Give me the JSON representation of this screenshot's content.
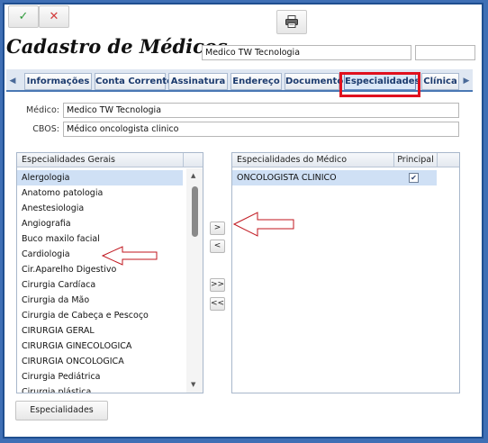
{
  "toolbar": {
    "confirm_icon": "✓",
    "cancel_icon": "✕",
    "print_icon": "🖶"
  },
  "header": {
    "title": "Cadastro de Médicos",
    "name_value": "Medico TW Tecnologia",
    "extra_value": ""
  },
  "tabs": {
    "items": [
      "Informações",
      "Conta Corrente",
      "Assinatura",
      "Endereço",
      "Documento",
      "Especialidades",
      "Clínica"
    ],
    "active": "Especialidades",
    "left_arrow": "◀",
    "right_arrow": "▶"
  },
  "form": {
    "medico_label": "Médico:",
    "medico_value": "Medico TW Tecnologia",
    "cbos_label": "CBOS:",
    "cbos_value": "Médico oncologista clinico"
  },
  "especialidades_gerais": {
    "header": "Especialidades Gerais",
    "items": [
      "Alergologia",
      "Anatomo patologia",
      "Anestesiologia",
      "Angiografia",
      "Buco maxilo facial",
      "Cardiologia",
      "Cir.Aparelho Digestivo",
      "Cirurgia Cardíaca",
      "Cirurgia da Mão",
      "Cirurgia de Cabeça e Pescoço",
      "CIRURGIA GERAL",
      "CIRURGIA GINECOLOGICA",
      "CIRURGIA ONCOLOGICA",
      "Cirurgia Pediátrica",
      "Cirurgia plástica"
    ],
    "selected": "Alergologia"
  },
  "transfer": {
    "add_one": ">",
    "remove_one": "<",
    "add_all": ">>",
    "remove_all": "<<"
  },
  "especialidades_medico": {
    "header_name": "Especialidades do Médico",
    "header_principal": "Principal",
    "rows": [
      {
        "name": "ONCOLOGISTA CLINICO",
        "principal": true
      }
    ]
  },
  "footer": {
    "button_label": "Especialidades"
  },
  "colors": {
    "border_blue": "#3f6fb5",
    "highlight_red": "#e0101e",
    "annotation_arrow": "#c0161e"
  }
}
